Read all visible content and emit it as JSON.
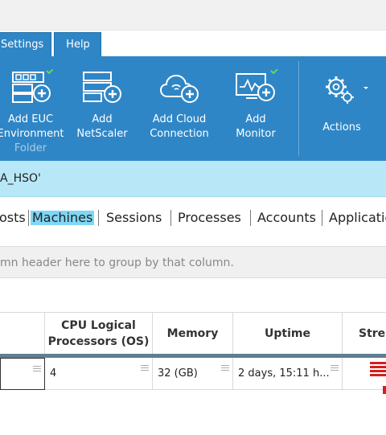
{
  "menu_tabs": {
    "settings": "Settings",
    "help": "Help"
  },
  "ribbon": {
    "items": [
      {
        "lines": [
          "Add EUC",
          "Environment",
          "Folder"
        ],
        "icon": "add-euc-environment-icon"
      },
      {
        "lines": [
          "Add",
          "NetScaler"
        ],
        "icon": "add-netscaler-icon"
      },
      {
        "lines": [
          "Add Cloud",
          "Connection"
        ],
        "icon": "add-cloud-connection-icon"
      },
      {
        "lines": [
          "Add",
          "Monitor"
        ],
        "icon": "add-monitor-icon"
      },
      {
        "lines": [
          "Actions"
        ],
        "icon": "actions-gear-icon"
      }
    ]
  },
  "breadcrumb": "A_HSO'",
  "view_tabs": [
    "osts",
    "Machines",
    "Sessions",
    "Processes",
    "Accounts",
    "Applicatio"
  ],
  "group_hint": "mn header here to group by that column.",
  "table": {
    "headers": [
      "",
      "CPU Logical Processors (OS)",
      "Memory",
      "Uptime",
      "Stre"
    ],
    "row": [
      "",
      "4",
      "32 (GB)",
      "2 days, 15:11 h..."
    ]
  },
  "colors": {
    "ribbon": "#2f86c6",
    "breadcrumb": "#b8e7f7",
    "active_tab": "#7fd7f5",
    "stress": "#d61f1f"
  }
}
